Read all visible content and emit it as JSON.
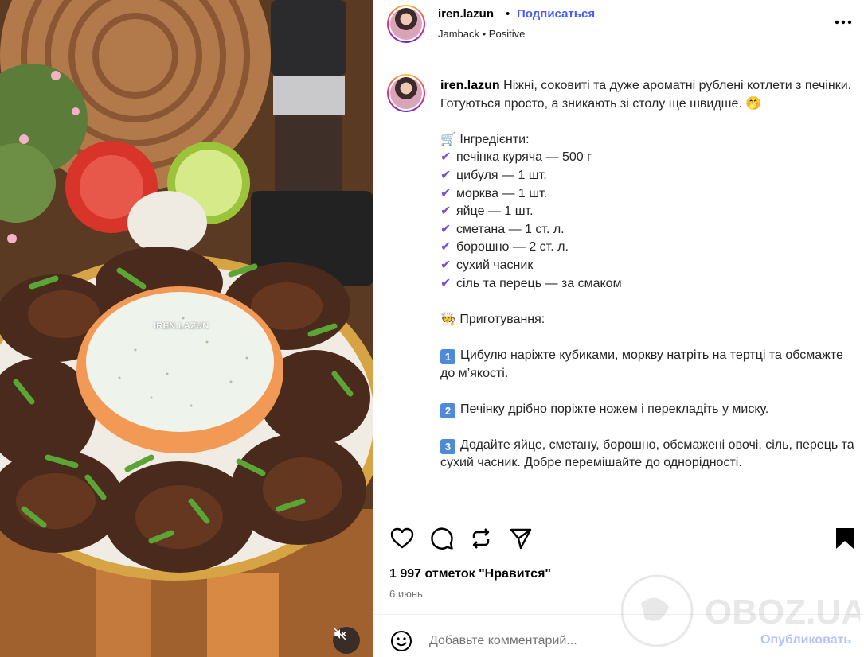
{
  "post": {
    "username": "iren.lazun",
    "separator": "•",
    "follow_label": "Подписаться",
    "audio": "Jamback • Positive",
    "more_icon": "more-horizontal-icon"
  },
  "media": {
    "overlay_text": "IREN.LAZUN",
    "mute_icon": "speaker-muted-icon"
  },
  "caption": {
    "username": "iren.lazun",
    "intro": "Ніжні, соковиті та дуже ароматні рублені котлети з печінки. Готуються просто, а зникають зі столу ще швидше. 🤭",
    "ingredients_title": "🛒 Інгредієнти:",
    "check_glyph": "✔",
    "ingredients": [
      "печінка куряча — 500 г",
      "цибуля — 1 шт.",
      "морква — 1 шт.",
      "яйце — 1 шт.",
      "сметана — 1 ст. л.",
      "борошно — 2 ст. л.",
      "сухий часник",
      "сіль та перець — за смаком"
    ],
    "method_title": "🧑‍🍳 Приготування:",
    "steps": [
      {
        "num": "1",
        "text": "Цибулю наріжте кубиками, моркву натріть на тертці та обсмажте до м’якості."
      },
      {
        "num": "2",
        "text": "Печінку дрібно поріжте ножем і перекладіть у миску."
      },
      {
        "num": "3",
        "text": "Додайте яйце, сметану, борошно, обсмажені овочі, сіль, перець та сухий часник. Добре перемішайте до однорідності."
      }
    ]
  },
  "actions": {
    "like_icon": "heart-icon",
    "comment_icon": "comment-icon",
    "repost_icon": "repost-icon",
    "share_icon": "send-icon",
    "save_icon": "bookmark-icon",
    "likes_text": "1 997 отметок \"Нравится\"",
    "date": "6 июнь"
  },
  "comment": {
    "emoji_icon": "smiley-icon",
    "placeholder": "Добавьте комментарий...",
    "publish_label": "Опубликовать"
  },
  "watermark": {
    "text": "OBOZ.UA"
  },
  "colors": {
    "follow": "#4a5df9",
    "publish_disabled": "#b3c4fb",
    "check": "#7b4fc9",
    "keycap": "#4f8ad8"
  }
}
